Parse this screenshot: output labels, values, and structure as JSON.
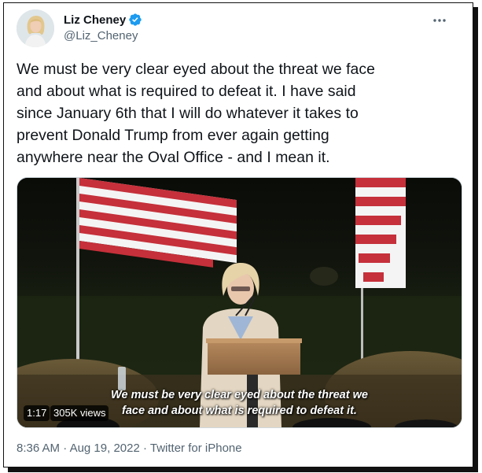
{
  "tweet": {
    "author": {
      "display_name": "Liz Cheney",
      "handle": "@Liz_Cheney",
      "verified_icon": "verified-badge-icon",
      "avatar_icon": "avatar"
    },
    "more_icon": "more-options-icon",
    "text_lines": [
      "We must be very clear eyed about the threat we face",
      "and about what is required to defeat it. I have said",
      "since January 6th that I will do whatever it takes to",
      "prevent Donald Trump from ever again getting",
      "anywhere near the Oval Office - and I mean it."
    ],
    "video": {
      "subtitle_line1": "We must be very clear eyed about the threat we",
      "subtitle_line2": "face and about what is required to defeat it.",
      "duration": "1:17",
      "views": "305K views"
    },
    "meta": {
      "time": "8:36 AM",
      "separator": " · ",
      "date": "Aug 19, 2022",
      "source": "Twitter for iPhone"
    }
  },
  "colors": {
    "verified_blue": "#1d9bf0",
    "text_primary": "#0f1419",
    "text_secondary": "#536471"
  }
}
